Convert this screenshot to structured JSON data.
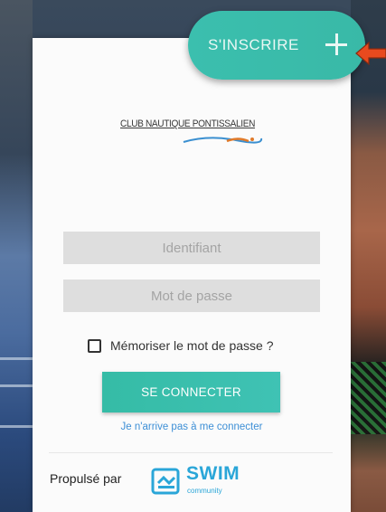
{
  "signup": {
    "label": "S'INSCRIRE"
  },
  "logo": {
    "text": "CLUB NAUTIQUE PONTISSALIEN"
  },
  "login": {
    "username_placeholder": "Identifiant",
    "password_placeholder": "Mot de passe",
    "remember_label": "Mémoriser le mot de passe ?",
    "remember_checked": false,
    "connect_label": "SE CONNECTER",
    "forgot_link": "Je n'arrive pas à me connecter"
  },
  "footer": {
    "powered_by": "Propulsé par",
    "brand_name": "SWIM",
    "brand_sub": "community"
  },
  "colors": {
    "accent": "#3bbfae",
    "link": "#3d8fd6",
    "arrow": "#e84a1e",
    "brand": "#2aa6d8"
  },
  "icons": {
    "plus": "plus-icon",
    "arrow": "arrow-left-icon",
    "checkbox": "checkbox-icon",
    "swim_logo": "swim-community-logo"
  }
}
